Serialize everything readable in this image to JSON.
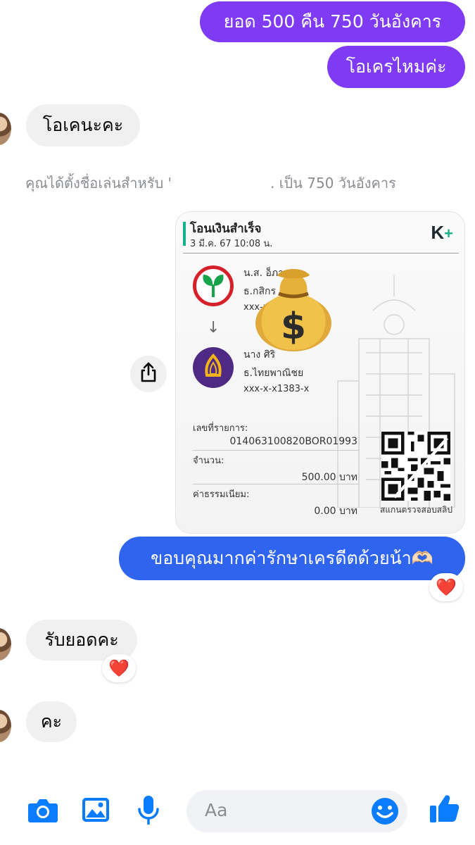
{
  "messages": {
    "out1": "ยอด 500 คืน 750 วันอังคาร",
    "out2": "โอเครไหมค่ะ",
    "in1": "โอเคนะคะ",
    "system_prefix": "คุณได้ตั้งชื่อเล่นสำหรับ ",
    "system_mark": "'",
    "system_suffix": ". เป็น 750 วันอังคาร",
    "out_thanks": "ขอบคุณมากค่ารักษาเครดีตด้วยน้า🫶🏻",
    "in2": "รับยอดคะ",
    "in3": "คะ"
  },
  "reactions": {
    "thanks": "❤️",
    "in2": "❤️"
  },
  "slip": {
    "title": "โอนเงินสำเร็จ",
    "datetime": "3 มี.ค. 67  10:08 น.",
    "brand_k": "K",
    "brand_plus": "+",
    "sender_name": "น.ส. อ็ภาษ",
    "sender_bank": "ธ.กสิกร",
    "sender_acc": "xxx-x",
    "receiver_name": "นาง                    ศิริ",
    "receiver_bank": "ธ.ไทยพาณิชย",
    "receiver_acc": "xxx-x-x1383-x",
    "ref_label": "เลขที่รายการ:",
    "ref_value": "014063100820BOR01993",
    "amount_label": "จำนวน:",
    "amount_value": "500.00 บาท",
    "fee_label": "ค่าธรรมเนียม:",
    "fee_value": "0.00 บาท",
    "qr_caption": "สแกนตรวจสอบสลิป"
  },
  "composer": {
    "placeholder": "Aa"
  },
  "icons": {
    "camera": "camera-icon",
    "gallery": "image-icon",
    "mic": "microphone-icon",
    "emoji": "emoji-icon",
    "like": "thumbs-up-icon",
    "share": "share-icon"
  },
  "colors": {
    "accent": "#0a7cff",
    "purple_bubble": "#7f3bf3",
    "blue_bubble": "#2f64ee",
    "incoming_bubble": "#f0f0f0",
    "kbank_green": "#17b28a"
  }
}
